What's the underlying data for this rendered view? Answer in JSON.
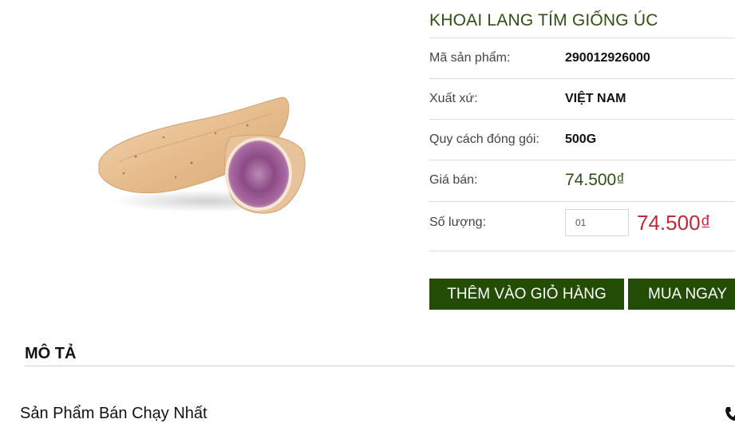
{
  "product": {
    "title": "KHOAI LANG TÍM GIỐNG ÚC",
    "image_icon": "purple-sweet-potato-image",
    "rows": [
      {
        "label": "Mã sản phẩm:",
        "value": "290012926000"
      },
      {
        "label": "Xuất xứ:",
        "value": "VIỆT NAM"
      },
      {
        "label": "Quy cách đóng gói:",
        "value": "500G"
      }
    ],
    "price_label": "Giá bán:",
    "price": "74.500₫",
    "quantity_label": "Số lượng:",
    "quantity_value": "01",
    "total_price": "74.500₫"
  },
  "buttons": {
    "add_to_cart": "THÊM VÀO GIỎ HÀNG",
    "buy_now": "MUA NGAY"
  },
  "description": {
    "title": "MÔ TẢ"
  },
  "bestseller": {
    "title": "Sản Phẩm Bán Chạy Nhất",
    "icon": "phone-icon"
  },
  "colors": {
    "brand_green": "#234d05",
    "title_green": "#2f4f14",
    "price_red": "#c2273b"
  }
}
